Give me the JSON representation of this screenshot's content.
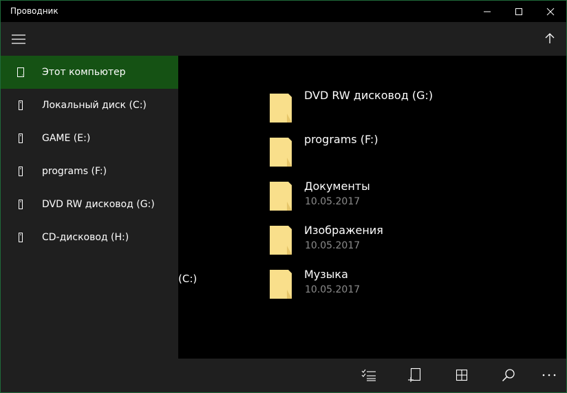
{
  "app": {
    "title": "Проводник"
  },
  "window_controls": [
    "minimize-icon",
    "maximize-icon",
    "close-icon"
  ],
  "sidebar": {
    "items": [
      {
        "label": "Этот компьютер",
        "icon": "computer-icon",
        "active": true
      },
      {
        "label": "Локальный диск (C:)",
        "icon": "drive-icon"
      },
      {
        "label": "GAME (E:)",
        "icon": "drive-icon"
      },
      {
        "label": "programs (F:)",
        "icon": "drive-icon"
      },
      {
        "label": "DVD RW дисковод (G:)",
        "icon": "drive-icon"
      },
      {
        "label": "CD-дисковод (H:)",
        "icon": "drive-icon"
      }
    ]
  },
  "files": [
    {
      "name": "DVD RW дисковод (G:)",
      "date": ""
    },
    {
      "name": "programs (F:)",
      "date": ""
    },
    {
      "name": "Документы",
      "date": "10.05.2017"
    },
    {
      "name": "Изображения",
      "date": "10.05.2017"
    },
    {
      "name": "Музыка",
      "date": "10.05.2017"
    }
  ],
  "stray_label": "(C:)",
  "command_bar": [
    "select-list-icon",
    "new-file-icon",
    "grid-view-icon",
    "search-icon",
    "more-icon"
  ],
  "colors": {
    "accent": "#155214",
    "sidebar_bg": "#1f1f1f",
    "content_bg": "#000000",
    "folder": "#f9df8b",
    "date_text": "#8c8c8c"
  }
}
